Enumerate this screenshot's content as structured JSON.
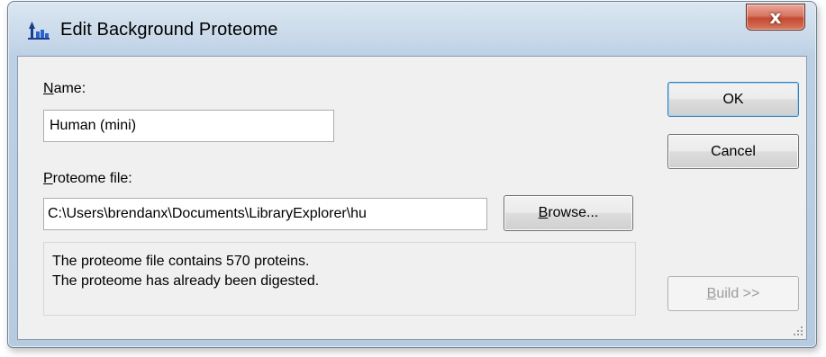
{
  "window": {
    "title": "Edit Background Proteome",
    "close_glyph": "x"
  },
  "form": {
    "name_label_hotkey": "N",
    "name_label_rest": "ame:",
    "name_value": "Human (mini)",
    "file_label_hotkey": "P",
    "file_label_rest": "roteome file:",
    "file_value": "C:\\Users\\brendanx\\Documents\\LibraryExplorer\\hu",
    "browse_hotkey": "B",
    "browse_rest": "rowse...",
    "info_line1": "The proteome file contains 570 proteins.",
    "info_line2": "The proteome has already been digested."
  },
  "buttons": {
    "ok": "OK",
    "cancel": "Cancel",
    "build_hotkey": "B",
    "build_rest": "uild >>"
  },
  "icons": {
    "app": "proteome-app-icon",
    "close": "close-icon",
    "resize": "resize-grip-icon"
  },
  "colors": {
    "titlebar": "#c9d9ea",
    "close_button": "#c44a32",
    "dialog_face": "#f0f0f0",
    "default_button_border": "#3c7fb1"
  }
}
